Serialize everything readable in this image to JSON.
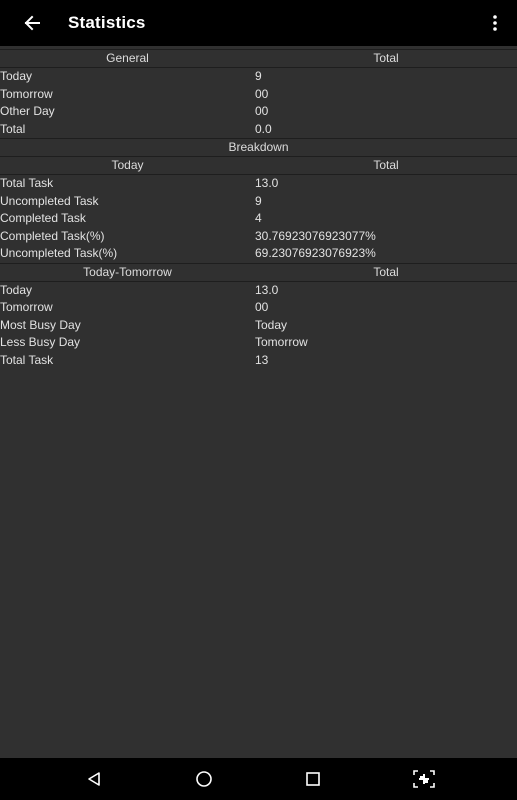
{
  "app_bar": {
    "title": "Statistics",
    "back_icon": "arrow-left-icon",
    "overflow_icon": "more-vertical-icon"
  },
  "general": {
    "header_left": "General",
    "header_right": "Total",
    "rows": [
      {
        "label": "Today",
        "value": "9"
      },
      {
        "label": "Tomorrow",
        "value": "00"
      },
      {
        "label": "Other Day",
        "value": "00"
      },
      {
        "label": "Total",
        "value": "0.0"
      }
    ]
  },
  "breakdown": {
    "title": "Breakdown",
    "header_left": "Today",
    "header_right": "Total",
    "rows": [
      {
        "label": "Total Task",
        "value": "13.0"
      },
      {
        "label": "Uncompleted Task",
        "value": "9"
      },
      {
        "label": "Completed Task",
        "value": "4"
      },
      {
        "label": "Completed Task(%)",
        "value": "30.76923076923077%"
      },
      {
        "label": "Uncompleted Task(%)",
        "value": "69.23076923076923%"
      }
    ]
  },
  "today_tomorrow": {
    "header_left": "Today-Tomorrow",
    "header_right": "Total",
    "rows": [
      {
        "label": "Today",
        "value": "13.0"
      },
      {
        "label": "Tomorrow",
        "value": "00"
      },
      {
        "label": "Most Busy Day",
        "value": "Today"
      },
      {
        "label": "Less Busy Day",
        "value": "Tomorrow"
      },
      {
        "label": "Total Task",
        "value": "13"
      }
    ]
  },
  "nav_bar": {
    "back_icon": "nav-back-triangle-icon",
    "home_icon": "nav-home-circle-icon",
    "recents_icon": "nav-recents-square-icon",
    "screenshot_icon": "screenshot-capture-icon"
  },
  "colors": {
    "background": "#303030",
    "bars": "#000000",
    "divider": "#1e1e1e",
    "text": "#e2e2e2"
  }
}
